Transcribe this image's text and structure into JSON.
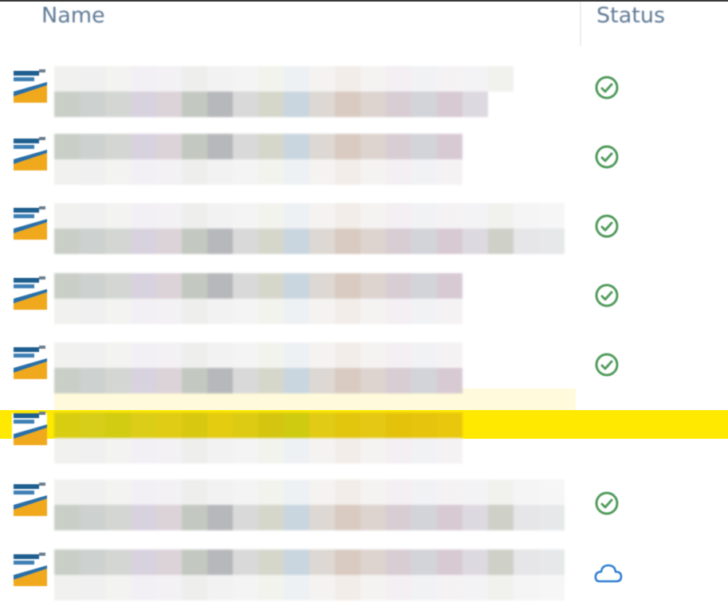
{
  "columns": {
    "name": "Name",
    "status": "Status"
  },
  "colors": {
    "selection": "#ffe900",
    "status_synced": "#4f9a5a",
    "status_cloud": "#2e7bd1"
  },
  "rows": [
    {
      "status": "synced",
      "status_icon": "checkmark-circle-icon",
      "selected": false,
      "name_redacted": true
    },
    {
      "status": "synced",
      "status_icon": "checkmark-circle-icon",
      "selected": false,
      "name_redacted": true
    },
    {
      "status": "synced",
      "status_icon": "checkmark-circle-icon",
      "selected": false,
      "name_redacted": true
    },
    {
      "status": "synced",
      "status_icon": "checkmark-circle-icon",
      "selected": false,
      "name_redacted": true
    },
    {
      "status": "synced",
      "status_icon": "checkmark-circle-icon",
      "selected": false,
      "name_redacted": true
    },
    {
      "status": "none",
      "status_icon": "",
      "selected": true,
      "name_redacted": true
    },
    {
      "status": "synced",
      "status_icon": "checkmark-circle-icon",
      "selected": false,
      "name_redacted": true
    },
    {
      "status": "cloud",
      "status_icon": "cloud-icon",
      "selected": false,
      "name_redacted": true
    }
  ]
}
